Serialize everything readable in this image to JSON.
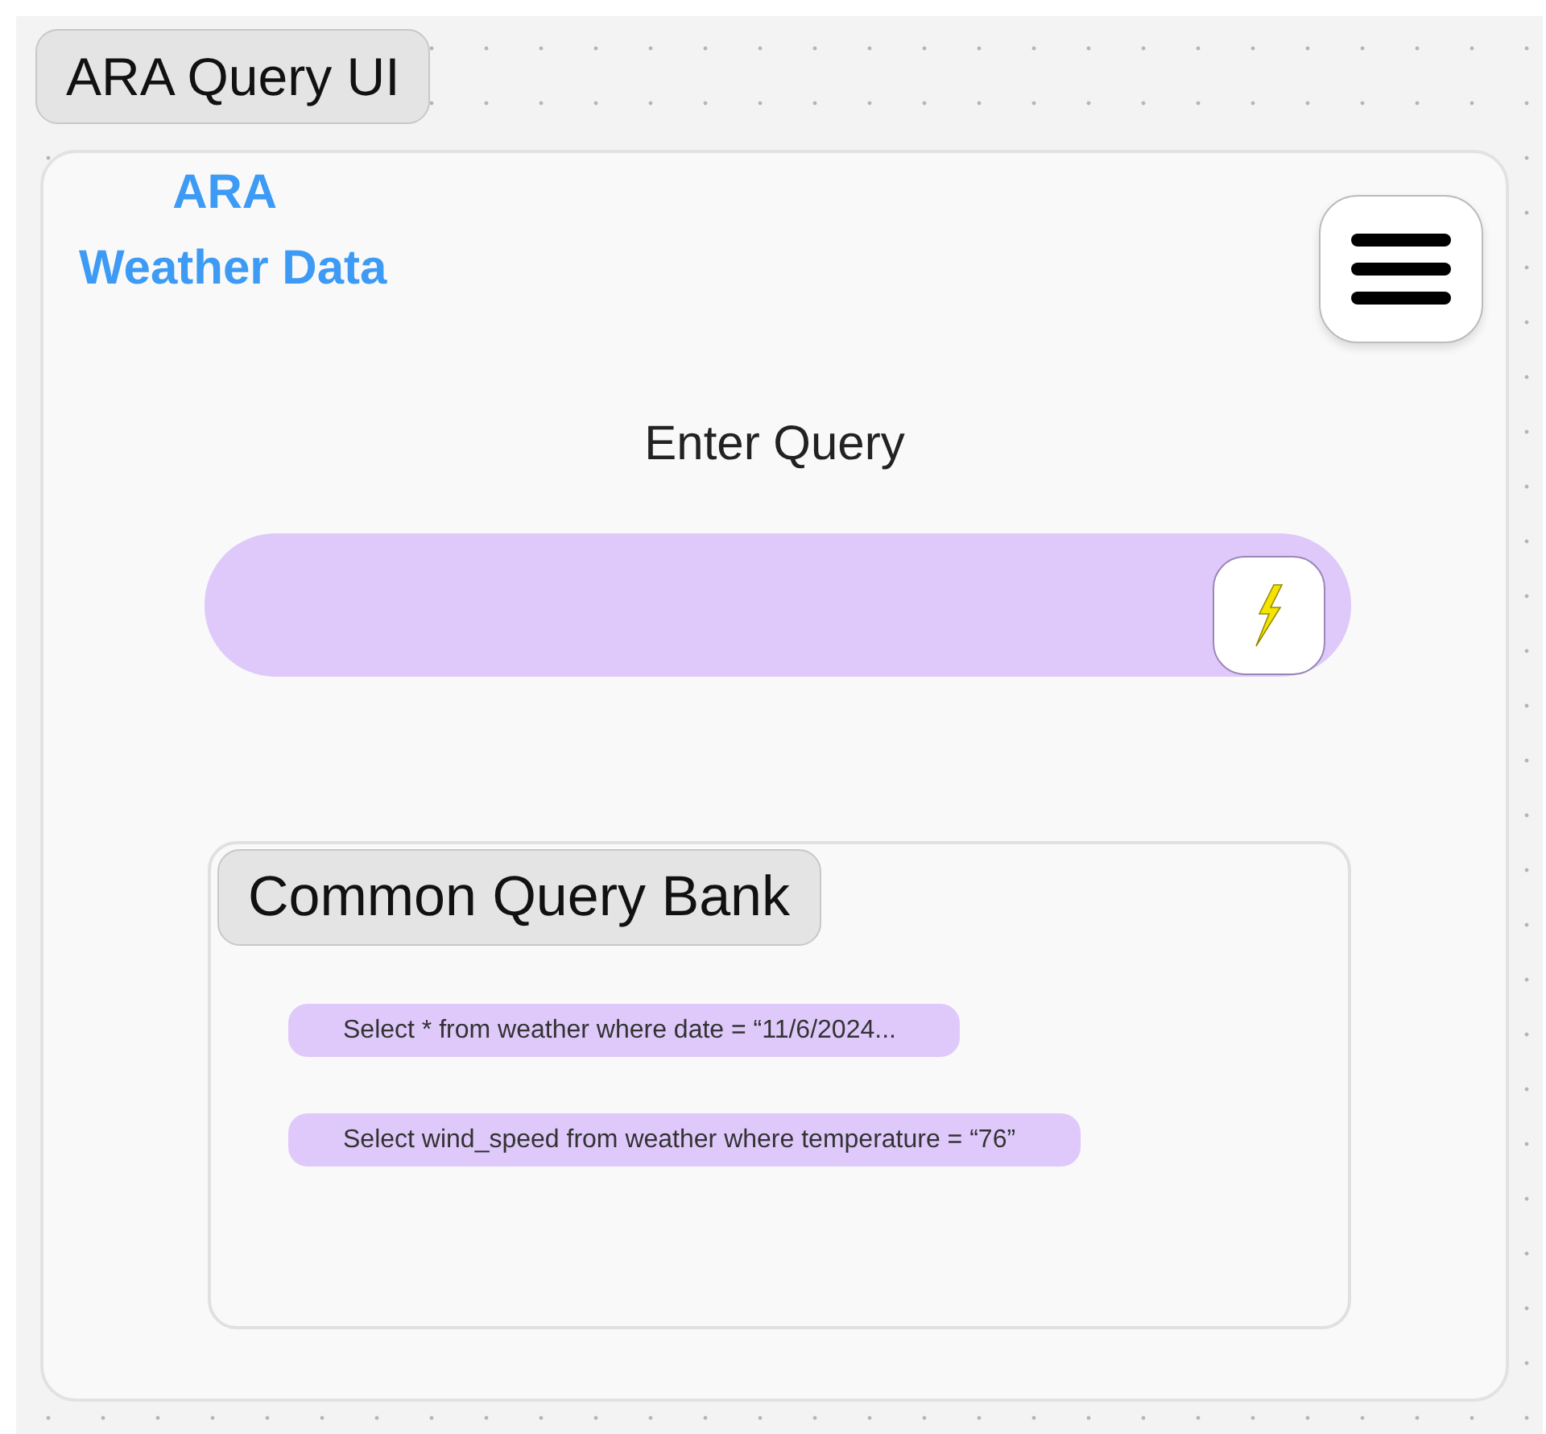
{
  "frame_label": "ARA Query UI",
  "brand": {
    "line_1": "ARA",
    "line_2": "Weather Data"
  },
  "query": {
    "heading": "Enter Query"
  },
  "query_bank": {
    "title": "Common Query Bank",
    "queries": [
      {
        "text": "Select * from weather where date = “11/6/2024..."
      },
      {
        "text": "Select wind_speed from weather where temperature = “76”"
      }
    ]
  }
}
